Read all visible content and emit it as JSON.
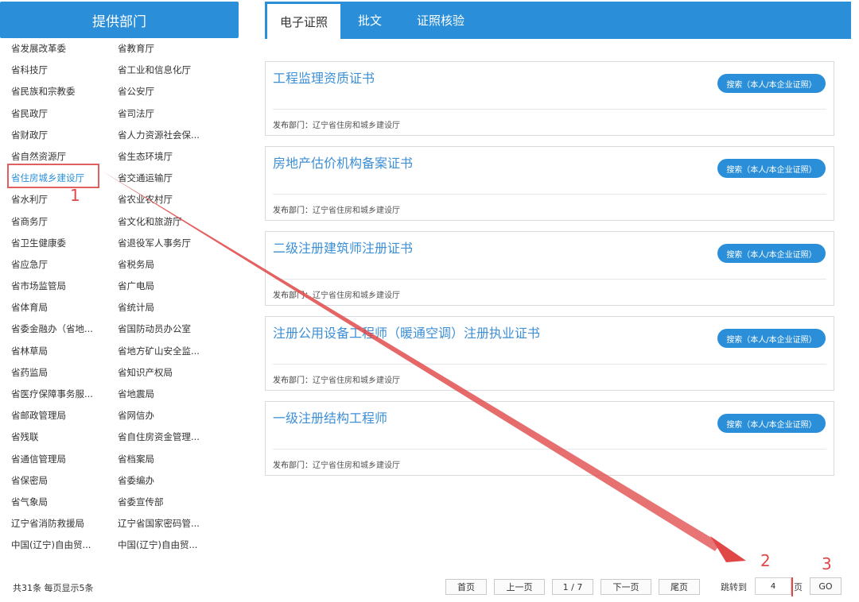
{
  "left_panel": {
    "header": "提供部门",
    "departments": [
      "省发展改革委",
      "省教育厅",
      "省科技厅",
      "省工业和信息化厅",
      "省民族和宗教委",
      "省公安厅",
      "省民政厅",
      "省司法厅",
      "省财政厅",
      "省人力资源社会保...",
      "省自然资源厅",
      "省生态环境厅",
      "省住房城乡建设厅",
      "省交通运输厅",
      "省水利厅",
      "省农业农村厅",
      "省商务厅",
      "省文化和旅游厅",
      "省卫生健康委",
      "省退役军人事务厅",
      "省应急厅",
      "省税务局",
      "省市场监管局",
      "省广电局",
      "省体育局",
      "省统计局",
      "省委金融办（省地...",
      "省国防动员办公室",
      "省林草局",
      "省地方矿山安全监...",
      "省药监局",
      "省知识产权局",
      "省医疗保障事务服...",
      "省地震局",
      "省邮政管理局",
      "省网信办",
      "省残联",
      "省自住房资金管理...",
      "省通信管理局",
      "省档案局",
      "省保密局",
      "省委编办",
      "省气象局",
      "省委宣传部",
      "辽宁省消防救援局",
      "辽宁省国家密码管...",
      "中国(辽宁)自由贸...",
      "中国(辽宁)自由贸..."
    ],
    "active_department": "省住房城乡建设厅",
    "total_info": "共31条  每页显示5条"
  },
  "tabs": [
    "电子证照",
    "批文",
    "证照核验"
  ],
  "active_tab": "电子证照",
  "cards": [
    {
      "title": "工程监理资质证书",
      "button": "搜索（本人/本企业证照）",
      "publisher_label": "发布部门：",
      "publisher": "辽宁省住房和城乡建设厅"
    },
    {
      "title": "房地产估价机构备案证书",
      "button": "搜索（本人/本企业证照）",
      "publisher_label": "发布部门：",
      "publisher": "辽宁省住房和城乡建设厅"
    },
    {
      "title": "二级注册建筑师注册证书",
      "button": "搜索（本人/本企业证照）",
      "publisher_label": "发布部门：",
      "publisher": "辽宁省住房和城乡建设厅"
    },
    {
      "title": "注册公用设备工程师（暖通空调）注册执业证书",
      "button": "搜索（本人/本企业证照）",
      "publisher_label": "发布部门：",
      "publisher": "辽宁省住房和城乡建设厅"
    },
    {
      "title": "一级注册结构工程师",
      "button": "搜索（本人/本企业证照）",
      "publisher_label": "发布部门：",
      "publisher": "辽宁省住房和城乡建设厅"
    }
  ],
  "pagination": {
    "first": "首页",
    "prev": "上一页",
    "current": "1 / 7",
    "next": "下一页",
    "last": "尾页",
    "jump_label": "跳转到",
    "jump_value": "4",
    "page_unit": "页",
    "go": "GO"
  },
  "annotations": [
    "1",
    "2",
    "3"
  ],
  "colors": {
    "accent": "#2a8fd8",
    "annotation": "#e04848"
  }
}
